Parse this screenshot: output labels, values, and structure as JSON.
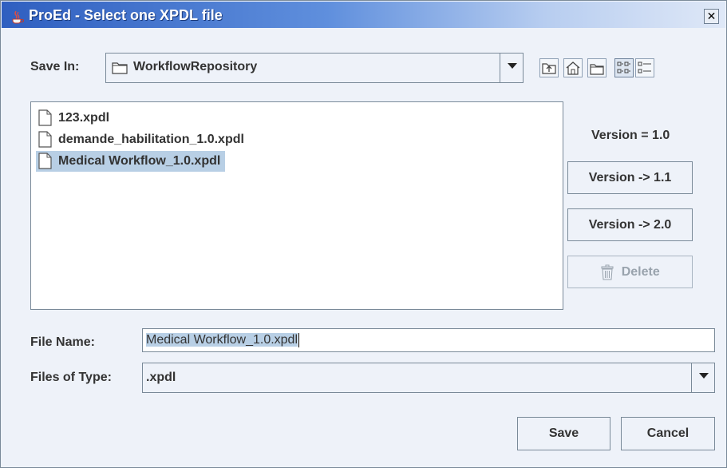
{
  "window": {
    "title": "ProEd - Select one XPDL file",
    "close_glyph": "✕"
  },
  "save_in": {
    "label": "Save In:",
    "value": "WorkflowRepository"
  },
  "toolbar": {
    "icons": [
      "up-one-level-icon",
      "home-icon",
      "new-folder-icon",
      "list-view-icon",
      "details-view-icon"
    ]
  },
  "files": [
    {
      "name": "123.xpdl",
      "selected": false
    },
    {
      "name": "demande_habilitation_1.0.xpdl",
      "selected": false
    },
    {
      "name": "Medical Workflow_1.0.xpdl",
      "selected": true
    }
  ],
  "side_panel": {
    "version_text": "Version = 1.0",
    "btn_v11": "Version -> 1.1",
    "btn_v20": "Version -> 2.0",
    "btn_delete": "Delete"
  },
  "file_name": {
    "label": "File Name:",
    "value": "Medical Workflow_1.0.xpdl"
  },
  "file_type": {
    "label": "Files of Type:",
    "value": ".xpdl"
  },
  "actions": {
    "save": "Save",
    "cancel": "Cancel"
  },
  "colors": {
    "title_gradient_start": "#2f5fc0",
    "selection": "#b8cfe5",
    "panel_bg": "#eef2f9"
  }
}
